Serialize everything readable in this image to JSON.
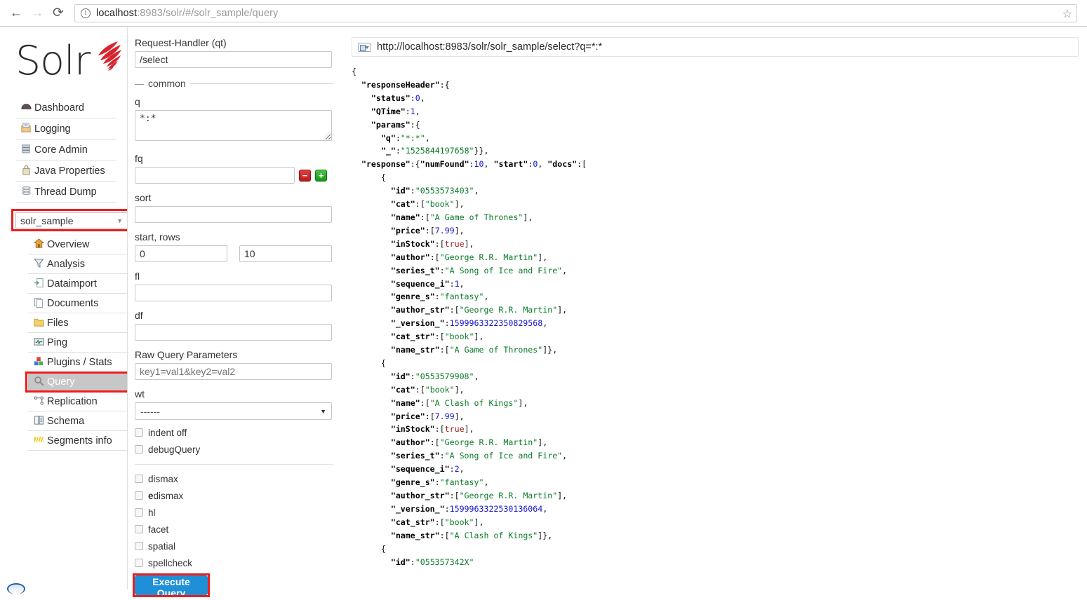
{
  "browser": {
    "back_icon": "arrow-left-icon",
    "forward_icon": "arrow-right-icon",
    "reload_icon": "reload-icon",
    "info_icon": "info-icon",
    "star_icon": "star-icon",
    "url_host": "localhost",
    "url_rest": ":8983/solr/#/solr_sample/query"
  },
  "sidebar": {
    "logo_text": "Solr",
    "main_items": [
      {
        "label": "Dashboard",
        "icon": "dashboard-gauge-icon"
      },
      {
        "label": "Logging",
        "icon": "logging-tray-icon"
      },
      {
        "label": "Core Admin",
        "icon": "core-admin-stack-icon"
      },
      {
        "label": "Java Properties",
        "icon": "java-properties-icon"
      },
      {
        "label": "Thread Dump",
        "icon": "thread-dump-layers-icon"
      }
    ],
    "core_selector": {
      "value": "solr_sample",
      "caret_icon": "chevron-down-icon",
      "highlight_color": "#ee1c1c"
    },
    "core_items": [
      {
        "label": "Overview",
        "icon": "home-icon",
        "active": false
      },
      {
        "label": "Analysis",
        "icon": "funnel-icon",
        "active": false
      },
      {
        "label": "Dataimport",
        "icon": "dataimport-icon",
        "active": false
      },
      {
        "label": "Documents",
        "icon": "documents-icon",
        "active": false
      },
      {
        "label": "Files",
        "icon": "folder-icon",
        "active": false
      },
      {
        "label": "Ping",
        "icon": "ping-monitor-icon",
        "active": false
      },
      {
        "label": "Plugins / Stats",
        "icon": "plugins-blocks-icon",
        "active": false
      },
      {
        "label": "Query",
        "icon": "magnifier-icon",
        "active": true
      },
      {
        "label": "Replication",
        "icon": "replication-icon",
        "active": false
      },
      {
        "label": "Schema",
        "icon": "book-icon",
        "active": false
      },
      {
        "label": "Segments info",
        "icon": "segments-icon",
        "active": false
      }
    ]
  },
  "query_form": {
    "request_handler_label": "Request-Handler (qt)",
    "request_handler_value": "/select",
    "legend_common": "common",
    "q_label": "q",
    "q_value": "*:*",
    "fq_label": "fq",
    "fq_value": "",
    "fq_minus_label": "−",
    "fq_plus_label": "+",
    "sort_label": "sort",
    "sort_value": "",
    "start_rows_label": "start, rows",
    "start_value": "0",
    "rows_value": "10",
    "fl_label": "fl",
    "fl_value": "",
    "df_label": "df",
    "df_value": "",
    "raw_params_label": "Raw Query Parameters",
    "raw_params_placeholder": "key1=val1&key2=val2",
    "wt_label": "wt",
    "wt_value": "------",
    "wt_caret_icon": "chevron-down-icon",
    "checkboxes_a": [
      {
        "label": "indent off",
        "checked": false
      },
      {
        "label": "debugQuery",
        "checked": false
      }
    ],
    "checkboxes_b": [
      {
        "label": "dismax",
        "checked": false,
        "bold_prefix": ""
      },
      {
        "label": "dismax",
        "checked": false,
        "bold_prefix": "e"
      },
      {
        "label": "hl",
        "checked": false,
        "bold_prefix": ""
      },
      {
        "label": "facet",
        "checked": false,
        "bold_prefix": ""
      },
      {
        "label": "spatial",
        "checked": false,
        "bold_prefix": ""
      },
      {
        "label": "spellcheck",
        "checked": false,
        "bold_prefix": ""
      }
    ],
    "execute_label": "Execute Query",
    "execute_color": "#1f90d8",
    "execute_highlight_color": "#ee1c1c"
  },
  "result": {
    "url_icon": "select-box-icon",
    "url": "http://localhost:8983/solr/solr_sample/select?q=*:*",
    "response": {
      "responseHeader": {
        "status": 0,
        "QTime": 1,
        "params": {
          "q": "*:*",
          "_": "1525844197658"
        }
      },
      "numFound": 10,
      "start": 0,
      "docs": [
        {
          "id": "0553573403",
          "cat": [
            "book"
          ],
          "name": [
            "A Game of Thrones"
          ],
          "price": [
            7.99
          ],
          "inStock": [
            true
          ],
          "author": [
            "George R.R. Martin"
          ],
          "series_t": "A Song of Ice and Fire",
          "sequence_i": 1,
          "genre_s": "fantasy",
          "author_str": [
            "George R.R. Martin"
          ],
          "_version_": "1599963322350829568",
          "cat_str": [
            "book"
          ],
          "name_str": [
            "A Game of Thrones"
          ]
        },
        {
          "id": "0553579908",
          "cat": [
            "book"
          ],
          "name": [
            "A Clash of Kings"
          ],
          "price": [
            7.99
          ],
          "inStock": [
            true
          ],
          "author": [
            "George R.R. Martin"
          ],
          "series_t": "A Song of Ice and Fire",
          "sequence_i": 2,
          "genre_s": "fantasy",
          "author_str": [
            "George R.R. Martin"
          ],
          "_version_": "1599963322530136064",
          "cat_str": [
            "book"
          ],
          "name_str": [
            "A Clash of Kings"
          ]
        },
        {
          "id": "055357342X"
        }
      ]
    },
    "syntax_colors": {
      "key": "#000000",
      "string": "#0a7a28",
      "number": "#1414cc",
      "boolean": "#9c1a1a"
    }
  }
}
